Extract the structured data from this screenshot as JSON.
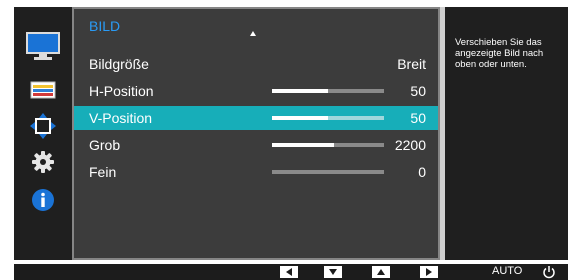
{
  "sidebar": {
    "items": [
      {
        "icon": "monitor-icon",
        "active": true
      },
      {
        "icon": "color-icon",
        "active": false
      },
      {
        "icon": "size-position-icon",
        "active": false
      },
      {
        "icon": "gear-icon",
        "active": false
      },
      {
        "icon": "info-icon",
        "active": false
      }
    ]
  },
  "menu": {
    "title": "BILD",
    "rows": [
      {
        "label": "Bildgröße",
        "value": "Breit"
      },
      {
        "label": "H-Position",
        "value": "50",
        "level": 0.5
      },
      {
        "label": "V-Position",
        "value": "50",
        "level": 0.5,
        "selected": true
      },
      {
        "label": "Grob",
        "value": "2200",
        "level": 0.55
      },
      {
        "label": "Fein",
        "value": "0",
        "level": 0.0
      }
    ]
  },
  "help": {
    "text": "Verschieben Sie das angezeigte Bild nach oben oder unten."
  },
  "bottom_bar": {
    "buttons": [
      "left-arrow-icon",
      "down-arrow-icon",
      "up-arrow-icon",
      "right-arrow-icon"
    ],
    "auto_label": "AUTO",
    "power_icon": "power-icon"
  },
  "colors": {
    "accent": "#17aeb9",
    "title": "#2a9bf5",
    "panel": "#3c3c3c"
  }
}
